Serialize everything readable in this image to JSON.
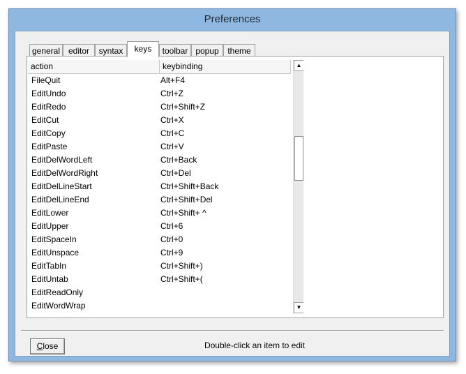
{
  "window": {
    "title": "Preferences"
  },
  "tabs": [
    "general",
    "editor",
    "syntax",
    "keys",
    "toolbar",
    "popup",
    "theme"
  ],
  "active_tab": "keys",
  "list": {
    "columns": [
      "action",
      "keybinding"
    ],
    "rows": [
      [
        "FileQuit",
        "Alt+F4"
      ],
      [
        "EditUndo",
        "Ctrl+Z"
      ],
      [
        "EditRedo",
        "Ctrl+Shift+Z"
      ],
      [
        "EditCut",
        "Ctrl+X"
      ],
      [
        "EditCopy",
        "Ctrl+C"
      ],
      [
        "EditPaste",
        "Ctrl+V"
      ],
      [
        "EditDelWordLeft",
        "Ctrl+Back"
      ],
      [
        "EditDelWordRight",
        "Ctrl+Del"
      ],
      [
        "EditDelLineStart",
        "Ctrl+Shift+Back"
      ],
      [
        "EditDelLineEnd",
        "Ctrl+Shift+Del"
      ],
      [
        "EditLower",
        "Ctrl+Shift+ ^"
      ],
      [
        "EditUpper",
        "Ctrl+6"
      ],
      [
        "EditSpaceIn",
        "Ctrl+0"
      ],
      [
        "EditUnspace",
        "Ctrl+9"
      ],
      [
        "EditTabIn",
        "Ctrl+Shift+)"
      ],
      [
        "EditUntab",
        "Ctrl+Shift+("
      ],
      [
        "EditReadOnly",
        ""
      ],
      [
        "EditWordWrap",
        ""
      ]
    ]
  },
  "scrollbar": {
    "up_icon": "up-arrow-icon",
    "down_icon": "down-arrow-icon"
  },
  "footer": {
    "close_label_first": "C",
    "close_label_rest": "lose",
    "hint": "Double-click an item to edit"
  },
  "colors": {
    "frame": "#8fb8e0",
    "client": "#f0f0f0"
  }
}
